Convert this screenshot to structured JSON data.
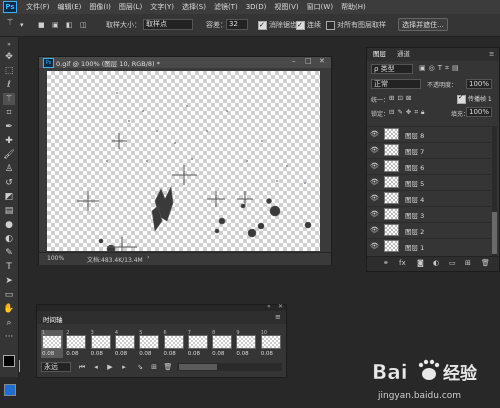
{
  "menu": [
    "文件(F)",
    "编辑(E)",
    "图像(I)",
    "图层(L)",
    "文字(Y)",
    "选择(S)",
    "滤镜(T)",
    "3D(D)",
    "视图(V)",
    "窗口(W)",
    "帮助(H)"
  ],
  "options": {
    "sample_size_label": "取样大小：",
    "sample_size_value": "取样点",
    "tolerance_label": "容差：",
    "tolerance_value": "32",
    "antialias_label": "消除锯齿",
    "contiguous_label": "连续",
    "all_layers_label": "对所有图层取样",
    "select_mask_button": "选择并遮住..."
  },
  "document": {
    "tab_title": "0.gif @ 100% (图层 10, RGB/8) *",
    "zoom": "100%",
    "doc_info": "文档:483.4K/13.4M"
  },
  "layers_panel": {
    "tabs": [
      "图层",
      "通道"
    ],
    "filter_kind": "ρ 类型",
    "blend_mode": "正常",
    "opacity_label": "不透明度：",
    "opacity_value": "100%",
    "unify_label": "统一：",
    "propagate_label": "传播帧 1",
    "lock_label": "锁定：",
    "fill_label": "填充：",
    "fill_value": "100%",
    "layers": [
      "图层 8",
      "图层 7",
      "图层 6",
      "图层 5",
      "图层 4",
      "图层 3",
      "图层 2",
      "图层 1"
    ]
  },
  "timeline": {
    "title": "时间轴",
    "frames": [
      {
        "num": "1",
        "delay": "0.08"
      },
      {
        "num": "2",
        "delay": "0.08"
      },
      {
        "num": "3",
        "delay": "0.08"
      },
      {
        "num": "4",
        "delay": "0.08"
      },
      {
        "num": "5",
        "delay": "0.08"
      },
      {
        "num": "6",
        "delay": "0.08"
      },
      {
        "num": "7",
        "delay": "0.08"
      },
      {
        "num": "8",
        "delay": "0.08"
      },
      {
        "num": "9",
        "delay": "0.08"
      },
      {
        "num": "10",
        "delay": "0.08"
      }
    ],
    "loop": "永远"
  },
  "watermark": {
    "brand": "Bai",
    "brand2": "经验",
    "url": "jingyan.baidu.com"
  },
  "colors": {
    "accent": "#3ab0ff",
    "panel_bg": "#353535",
    "app_bg": "#282828"
  }
}
